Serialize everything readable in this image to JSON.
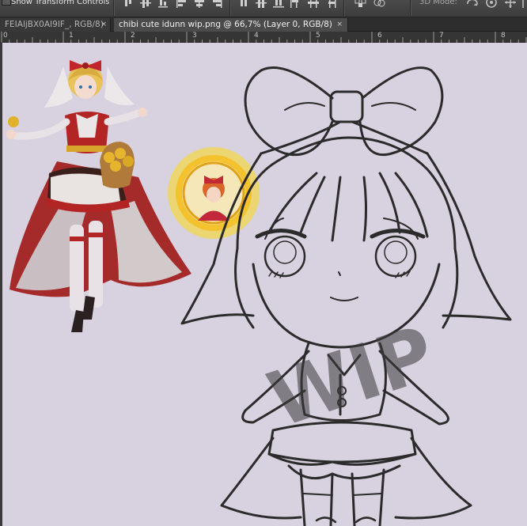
{
  "options_bar": {
    "show_transform_controls_label": "Show Transform Controls",
    "show_transform_controls_checked": false,
    "mode_label": "3D Mode:"
  },
  "tabs": [
    {
      "label": "FEIAljBX0AI9IF_, RGB/8)",
      "active": false,
      "close": "×"
    },
    {
      "label": "chibi cute idunn wip.png @ 66,7% (Layer 0, RGB/8)",
      "active": true,
      "close": "×"
    }
  ],
  "ruler": {
    "numbers": [
      "0",
      "1",
      "2",
      "3",
      "4",
      "5",
      "6",
      "7",
      "8"
    ]
  },
  "canvas": {
    "background": "#d8d1df",
    "watermark_text": "WIP",
    "line_color": "#2b2b2b"
  }
}
